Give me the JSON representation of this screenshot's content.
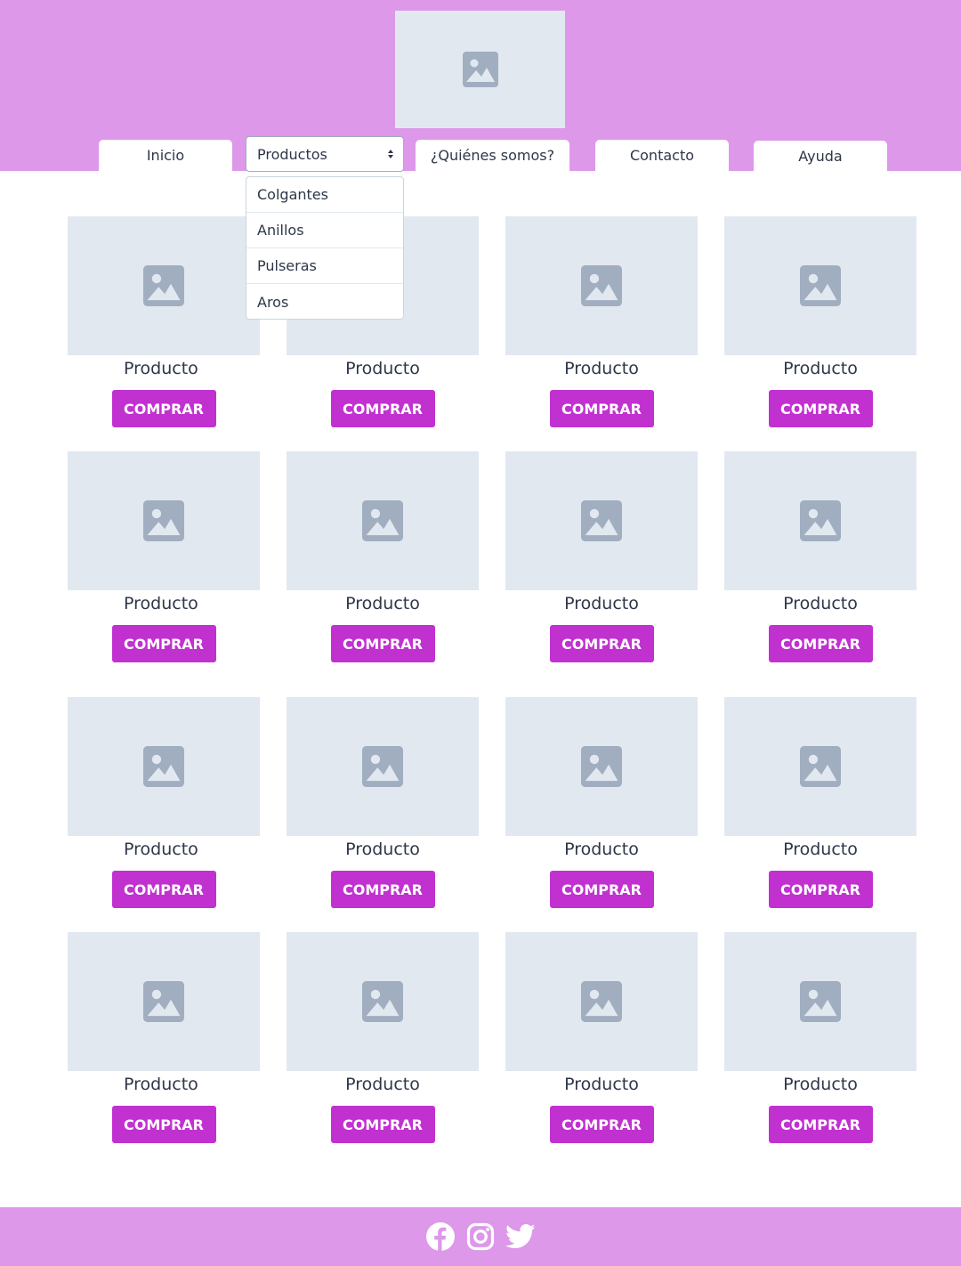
{
  "nav": {
    "home": "Inicio",
    "products_select": "Productos",
    "about": "¿Quiénes somos?",
    "contact": "Contacto",
    "help": "Ayuda"
  },
  "dropdown": {
    "options": [
      "Colgantes",
      "Anillos",
      "Pulseras",
      "Aros"
    ]
  },
  "products": [
    {
      "name": "Producto",
      "button": "COMPRAR"
    },
    {
      "name": "Producto",
      "button": "COMPRAR"
    },
    {
      "name": "Producto",
      "button": "COMPRAR"
    },
    {
      "name": "Producto",
      "button": "COMPRAR"
    },
    {
      "name": "Producto",
      "button": "COMPRAR"
    },
    {
      "name": "Producto",
      "button": "COMPRAR"
    },
    {
      "name": "Producto",
      "button": "COMPRAR"
    },
    {
      "name": "Producto",
      "button": "COMPRAR"
    },
    {
      "name": "Producto",
      "button": "COMPRAR"
    },
    {
      "name": "Producto",
      "button": "COMPRAR"
    },
    {
      "name": "Producto",
      "button": "COMPRAR"
    },
    {
      "name": "Producto",
      "button": "COMPRAR"
    },
    {
      "name": "Producto",
      "button": "COMPRAR"
    },
    {
      "name": "Producto",
      "button": "COMPRAR"
    },
    {
      "name": "Producto",
      "button": "COMPRAR"
    },
    {
      "name": "Producto",
      "button": "COMPRAR"
    }
  ],
  "footer": {
    "icons": [
      "facebook-icon",
      "instagram-icon",
      "twitter-icon"
    ]
  },
  "colors": {
    "header_bg": "#dd98ea",
    "button_bg": "#c131d0",
    "placeholder_bg": "#e2e8f0",
    "placeholder_icon": "#a0aec0"
  }
}
